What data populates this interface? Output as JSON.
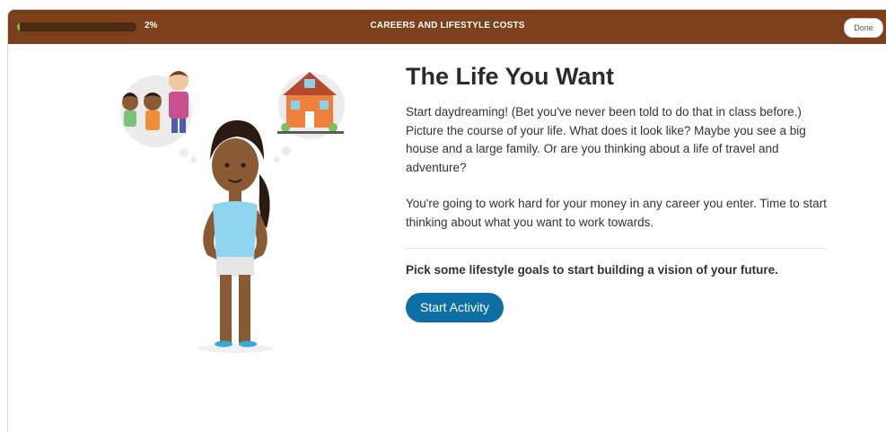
{
  "header": {
    "progress_label": "2%",
    "progress_fraction": 0.02,
    "title": "CAREERS AND LIFESTYLE COSTS",
    "done_label": "Done"
  },
  "illustration": {
    "icons": [
      "family-thought-bubble-icon",
      "house-thought-bubble-icon",
      "girl-character-icon"
    ]
  },
  "main": {
    "heading": "The Life You Want",
    "paragraph1": "Start daydreaming! (Bet you've never been told to do that in class before.) Picture the course of your life. What does it look like? Maybe you see a big house and a large family. Or are you thinking about a life of travel and adventure?",
    "paragraph2": "You're going to work hard for your money in any career you enter. Time to start thinking about what you want to work towards.",
    "prompt": "Pick some lifestyle goals to start building a vision of your future.",
    "start_button_label": "Start Activity"
  },
  "colors": {
    "topbar": "#7b3f19",
    "progress": "#72c24b",
    "button": "#0e6fa5"
  }
}
